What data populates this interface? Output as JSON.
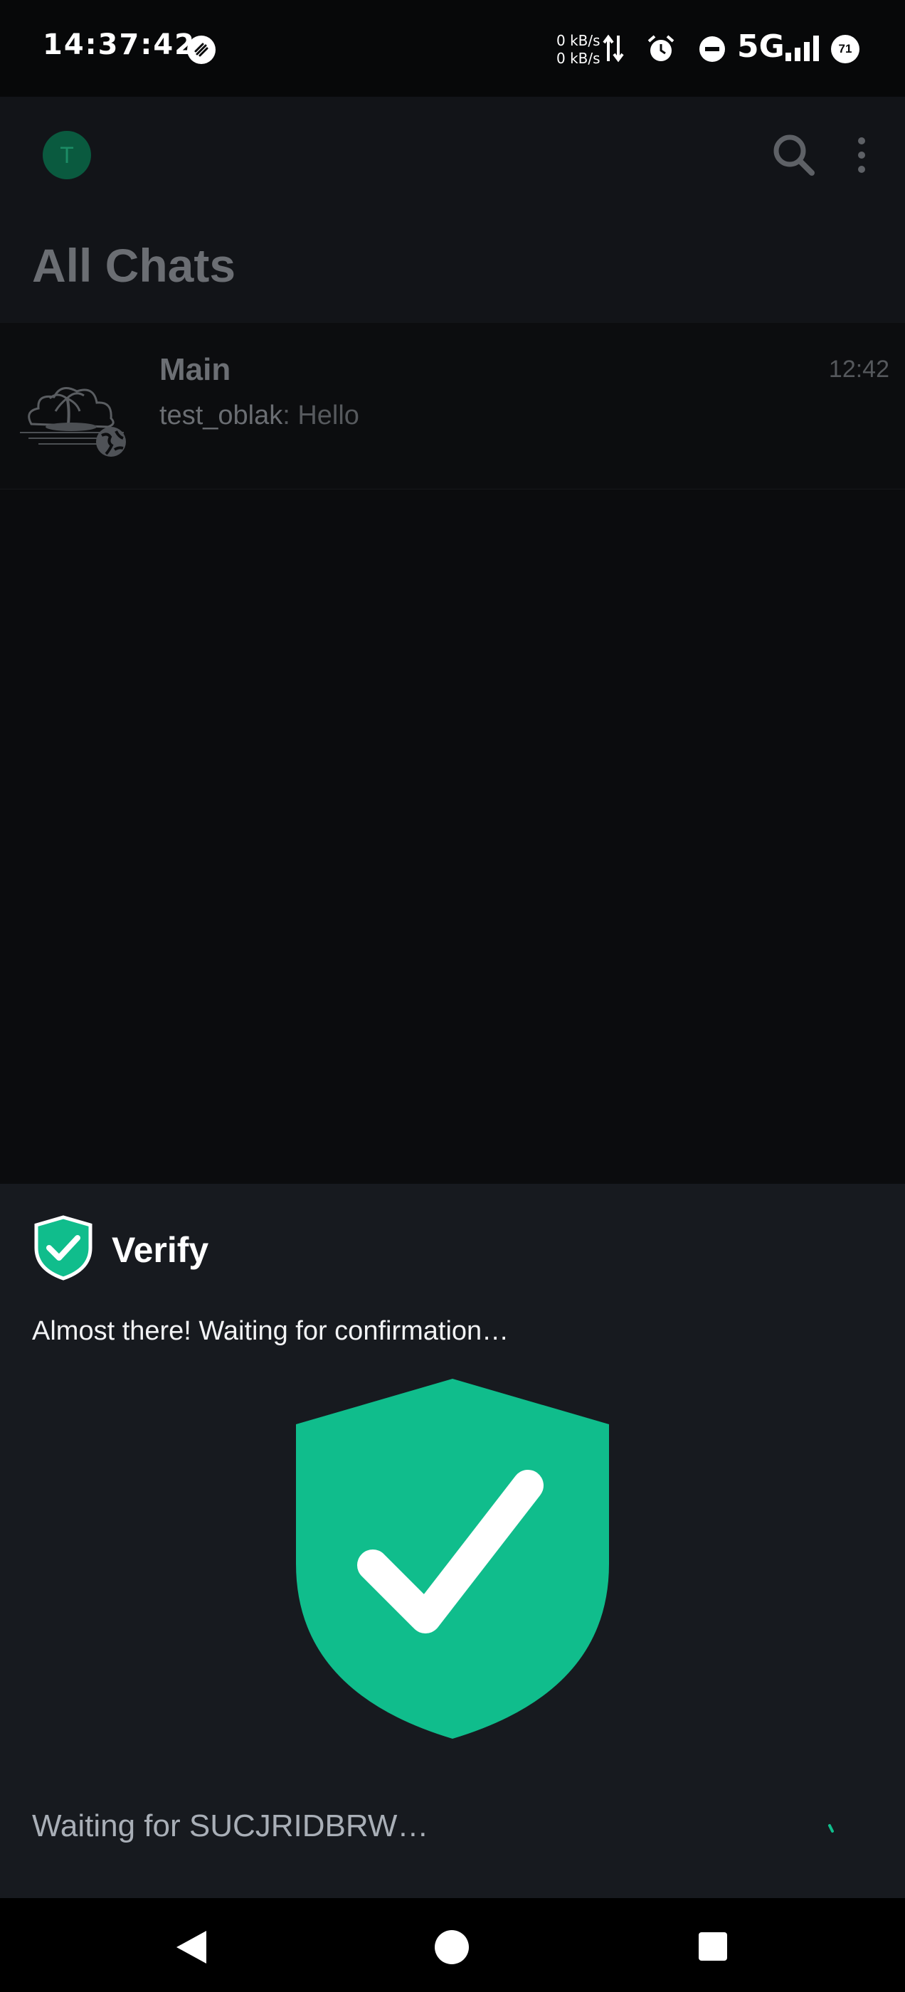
{
  "status_bar": {
    "time": "14:37:42",
    "upload_speed": "0 kB/s",
    "download_speed": "0 kB/s",
    "network": "5G",
    "battery": "71"
  },
  "header": {
    "avatar_letter": "T",
    "title": "All Chats"
  },
  "chats": [
    {
      "name": "Main",
      "time": "12:42",
      "sender": "test_oblak",
      "message": ": Hello"
    }
  ],
  "verify_sheet": {
    "title": "Verify",
    "message": "Almost there! Waiting for confirmation…",
    "waiting_text": "Waiting for SUCJRIDBRW…",
    "accent_color": "#10bd8c"
  },
  "colors": {
    "background": "#0a0b0d",
    "sheet": "#171a1f",
    "accent": "#10bd8c"
  }
}
